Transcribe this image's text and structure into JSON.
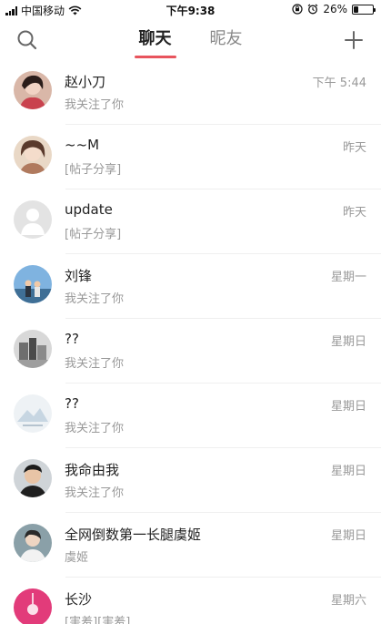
{
  "status_bar": {
    "carrier": "中国移动",
    "time": "下午9:38",
    "battery": "26%",
    "battery_level": 0.26,
    "icons": [
      "signal-icon",
      "wifi-icon",
      "orientation-lock-icon",
      "alarm-icon",
      "battery-icon"
    ]
  },
  "header": {
    "tabs": [
      {
        "label": "聊天",
        "active": true
      },
      {
        "label": "昵友",
        "active": false
      }
    ],
    "icons": [
      "search-icon",
      "plus-icon"
    ]
  },
  "colors": {
    "accent": "#e8545d",
    "primary_text": "#222222",
    "secondary_text": "#999999"
  },
  "conversations": [
    {
      "name": "赵小刀",
      "preview": "我关注了你",
      "time": "下午 5:44"
    },
    {
      "name": "~~M",
      "preview": "[帖子分享]",
      "time": "昨天"
    },
    {
      "name": "update",
      "preview": "[帖子分享]",
      "time": "昨天"
    },
    {
      "name": "刘锋",
      "preview": "我关注了你",
      "time": "星期一"
    },
    {
      "name": "??",
      "preview": "我关注了你",
      "time": "星期日"
    },
    {
      "name": "??",
      "preview": "我关注了你",
      "time": "星期日"
    },
    {
      "name": "我命由我",
      "preview": "我关注了你",
      "time": "星期日"
    },
    {
      "name": "全网倒数第一长腿虞姬",
      "preview": "虞姬",
      "time": "星期日"
    },
    {
      "name": "长沙",
      "preview": "[害羞][害羞]",
      "time": "星期六"
    }
  ]
}
